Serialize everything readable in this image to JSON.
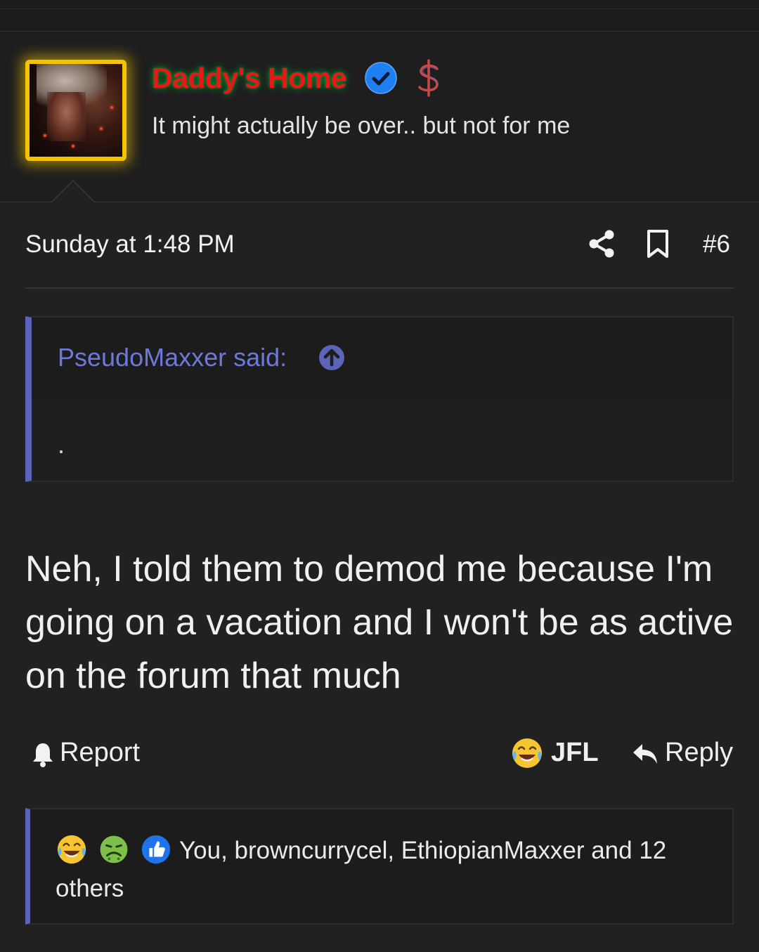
{
  "user": {
    "name": "Daddy's Home",
    "title": "It might actually be over.. but not for me",
    "name_color": "#e81818",
    "avatar_border_color": "#f5c400",
    "icons": [
      "verified-icon",
      "dollar-icon"
    ]
  },
  "post": {
    "date": "Sunday at 1:48 PM",
    "number": "#6",
    "actions_icons": [
      "share-icon",
      "bookmark-icon"
    ],
    "body": "Neh, I told them to demod me because I'm going on a vacation and I won't be as active on the forum that much"
  },
  "quote": {
    "author": "PseudoMaxxer said:",
    "content": ".",
    "accent_color": "#5b64b8"
  },
  "footer": {
    "report_label": "Report",
    "jfl_label": "JFL",
    "reply_label": "Reply"
  },
  "reactions": {
    "icons": [
      "laughing-crying-emoji-icon",
      "sick-face-emoji-icon",
      "thumbs-up-icon"
    ],
    "summary": "You, browncurrycel, EthiopianMaxxer and 12 others"
  }
}
